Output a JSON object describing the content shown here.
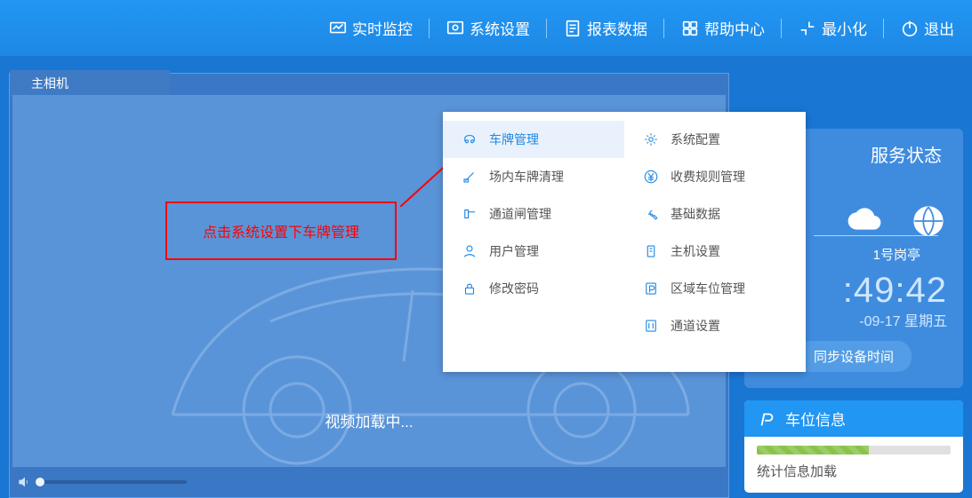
{
  "topbar": {
    "items": [
      {
        "label": "实时监控"
      },
      {
        "label": "系统设置"
      },
      {
        "label": "报表数据"
      },
      {
        "label": "帮助中心"
      },
      {
        "label": "最小化"
      },
      {
        "label": "退出"
      }
    ]
  },
  "camera": {
    "tab_label": "主相机",
    "loading_text": "视频加载中..."
  },
  "annotation": {
    "text": "点击系统设置下车牌管理"
  },
  "dropdown": {
    "left": [
      {
        "label": "车牌管理",
        "selected": true
      },
      {
        "label": "场内车牌清理"
      },
      {
        "label": "通道闸管理"
      },
      {
        "label": "用户管理"
      },
      {
        "label": "修改密码"
      }
    ],
    "right": [
      {
        "label": "系统配置"
      },
      {
        "label": "收费规则管理"
      },
      {
        "label": "基础数据"
      },
      {
        "label": "主机设置"
      },
      {
        "label": "区域车位管理"
      },
      {
        "label": "通道设置"
      }
    ]
  },
  "status": {
    "title": "服务状态",
    "station": "1号岗亭",
    "time": ":49:42",
    "date": "-09-17 星期五",
    "sync_btn": "同步设备时间"
  },
  "slot": {
    "title": "车位信息",
    "loading": "统计信息加载"
  }
}
